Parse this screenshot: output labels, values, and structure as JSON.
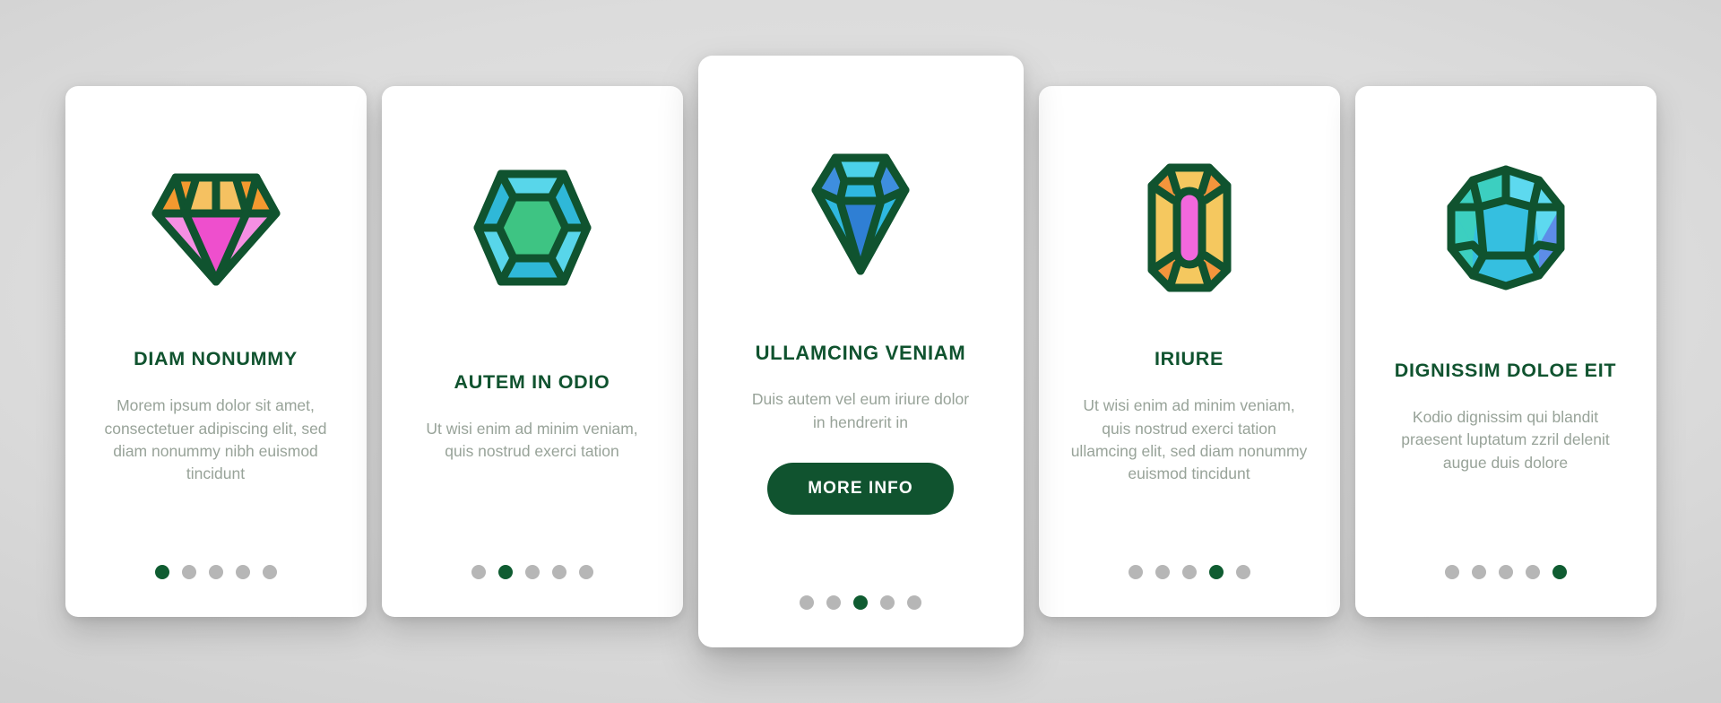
{
  "theme": {
    "accent_green": "#10532f",
    "body_text_color": "#98a399",
    "dot_inactive": "#b6b6b6",
    "dot_active": "#0f5c31",
    "card_background": "#ffffff",
    "page_background": "#d6d6d6",
    "gem_outline": "#10532f"
  },
  "cards": [
    {
      "icon_name": "diamond-brilliant-pink-icon",
      "title": "DIAM NONUMMY",
      "body": "Morem ipsum dolor sit amet, consectetuer adipiscing elit, sed diam nonummy nibh euismod tincidunt",
      "dots": {
        "count": 5,
        "active_index": 0
      },
      "has_button": false
    },
    {
      "icon_name": "gem-hexagon-green-icon",
      "title": "AUTEM IN ODIO",
      "body": "Ut wisi enim ad minim veniam, quis nostrud exerci tation",
      "dots": {
        "count": 5,
        "active_index": 1
      },
      "has_button": false
    },
    {
      "icon_name": "diamond-brilliant-blue-icon",
      "title": "ULLAMCING VENIAM",
      "body": "Duis autem vel eum iriure dolor in hendrerit in",
      "button_label": "MORE INFO",
      "dots": {
        "count": 5,
        "active_index": 2
      },
      "has_button": true,
      "featured": true
    },
    {
      "icon_name": "gem-emerald-cut-pink-icon",
      "title": "IRIURE",
      "body": "Ut wisi enim ad minim veniam, quis nostrud exerci tation ullamcing elit, sed diam nonummy euismod tincidunt",
      "dots": {
        "count": 5,
        "active_index": 3
      },
      "has_button": false
    },
    {
      "icon_name": "gem-dodecahedron-cyan-icon",
      "title": "DIGNISSIM DOLOE EIT",
      "body": "Kodio dignissim qui blandit praesent luptatum zzril delenit augue duis dolore",
      "dots": {
        "count": 5,
        "active_index": 4
      },
      "has_button": false
    }
  ],
  "gem_colors": {
    "diamond_pink": {
      "crown_light": "#f5c161",
      "crown_dark": "#f4992f",
      "pavilion_light": "#f58fe3",
      "pavilion_dark": "#ee4fcd"
    },
    "hexagon_green": {
      "center": "#3ec483",
      "facet_light": "#58d6ea",
      "facet_mid": "#2fb8d8",
      "facet_blue": "#35bdf0"
    },
    "diamond_blue": {
      "table": "#4bd1e8",
      "crown": "#3e8ede",
      "pavilion_light": "#2fb8e0",
      "pavilion_dark": "#2f7fd4"
    },
    "emerald_pink": {
      "body": "#f5c85f",
      "corner": "#f3953c",
      "center": "#f268dd"
    },
    "dodeca_cyan": {
      "center": "#35bfe0",
      "teal": "#3ccfc0",
      "light": "#5dd9ef",
      "blue": "#5d8de8"
    }
  }
}
